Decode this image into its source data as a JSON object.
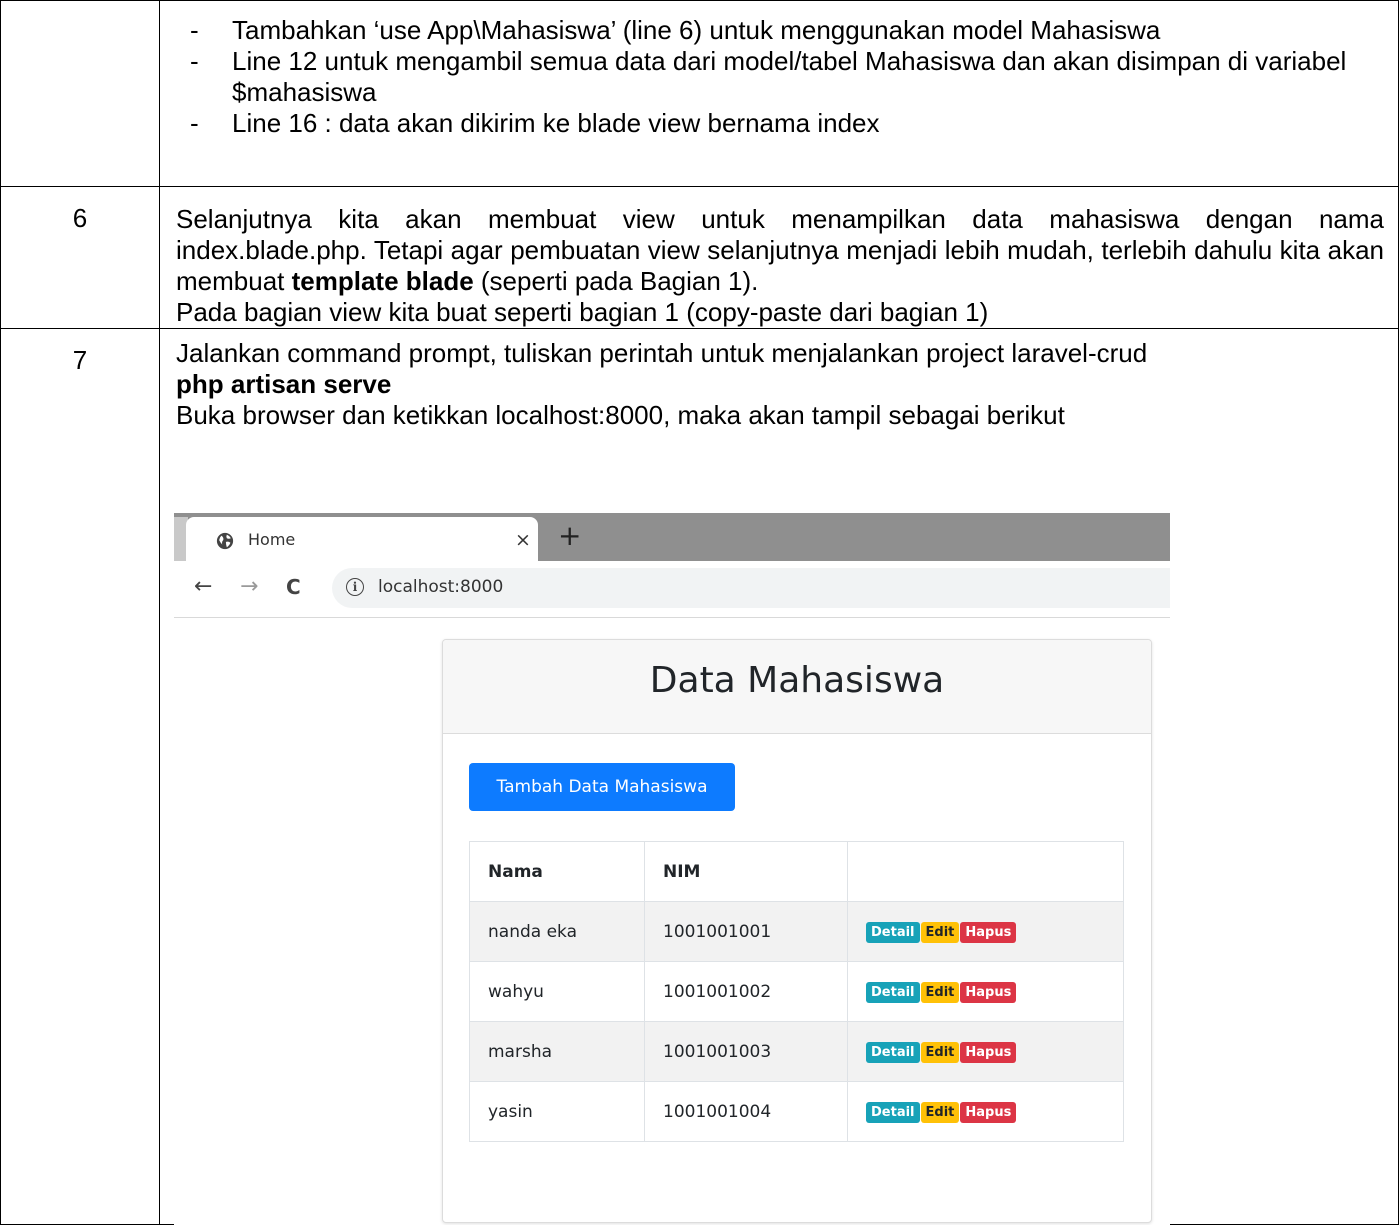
{
  "row1": {
    "bullets": [
      "Tambahkan ‘use App\\Mahasiswa’ (line 6) untuk menggunakan model Mahasiswa",
      "Line 12 untuk mengambil semua data dari model/tabel Mahasiswa dan akan disimpan di variabel $mahasiswa",
      "Line 16 : data akan dikirim ke blade view bernama index"
    ]
  },
  "row2": {
    "number": "6",
    "text_before_bold": "Selanjutnya kita akan membuat view untuk menampilkan data mahasiswa dengan nama index.blade.php. Tetapi agar pembuatan view selanjutnya menjadi lebih mudah, terlebih dahulu kita akan membuat ",
    "bold": "template blade",
    "text_after_bold": " (seperti pada Bagian 1).",
    "line2": "Pada bagian view kita buat seperti bagian 1 (copy-paste dari bagian 1)"
  },
  "row3": {
    "number": "7",
    "line1": "Jalankan command prompt, tuliskan perintah untuk menjalankan project laravel-crud",
    "command": "php artisan  serve",
    "line3": "Buka browser dan ketikkan localhost:8000, maka akan tampil sebagai berikut"
  },
  "browser": {
    "tab_title": "Home",
    "close_glyph": "×",
    "new_tab_glyph": "+",
    "back_glyph": "←",
    "forward_glyph": "→",
    "reload_glyph": "C",
    "info_glyph": "i",
    "url": "localhost:8000",
    "page": {
      "title": "Data Mahasiswa",
      "add_button": "Tambah Data Mahasiswa",
      "columns": [
        "Nama",
        "NIM",
        ""
      ],
      "badges": {
        "detail": "Detail",
        "edit": "Edit",
        "hapus": "Hapus"
      },
      "rows": [
        {
          "nama": "nanda eka",
          "nim": "1001001001"
        },
        {
          "nama": "wahyu",
          "nim": "1001001002"
        },
        {
          "nama": "marsha",
          "nim": "1001001003"
        },
        {
          "nama": "yasin",
          "nim": "1001001004"
        }
      ]
    }
  },
  "colors": {
    "primary": "#0d7bff",
    "detail": "#17a2b8",
    "edit": "#ffc107",
    "hapus": "#dc3545"
  }
}
